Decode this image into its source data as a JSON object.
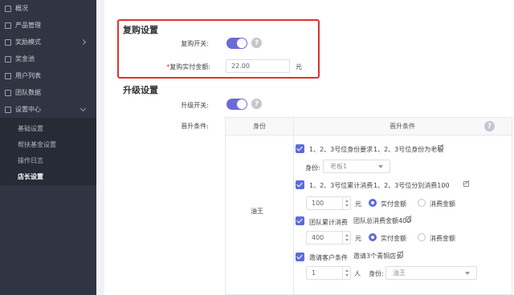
{
  "sidebar": {
    "items": [
      {
        "label": "概况"
      },
      {
        "label": "产品管理"
      },
      {
        "label": "奖励模式"
      },
      {
        "label": "奖金池"
      },
      {
        "label": "用户列表"
      },
      {
        "label": "团队数据"
      },
      {
        "label": "设置中心"
      }
    ],
    "sub_items": [
      {
        "label": "基础设置"
      },
      {
        "label": "帮扶基金设置"
      },
      {
        "label": "操作日志"
      },
      {
        "label": "店长设置"
      }
    ],
    "active_sub": "店长设置"
  },
  "repurchase": {
    "title": "复购设置",
    "switch_label": "复购开关:",
    "switch_on": true,
    "amount_label": "复购实付金额:",
    "amount_value": "22.00",
    "amount_unit": "元"
  },
  "upgrade": {
    "title": "升级设置",
    "switch_label": "升级开关:",
    "switch_on": true,
    "condition_label": "晋升条件:",
    "table": {
      "col_identity": "身份",
      "col_condition": "晋升条件",
      "row_identity": "油王",
      "conditions": {
        "c1_label": "1、2、3号位身份要求",
        "c1_desc": "1、2、3号位身份为老板",
        "identity_label": "身份:",
        "identity_value": "老板1",
        "c2_label": "1、2、3号位累计消费",
        "c2_desc": "1、2、3号位分别消费100",
        "c2_value": "100",
        "c2_unit": "元",
        "radio_paid": "实付金额",
        "radio_consume": "消费金额",
        "c3_label": "团队累计消费",
        "c3_desc": "团队总消费金额400",
        "c3_value": "400",
        "c3_unit": "元",
        "c4_label": "邀请客户条件",
        "c4_desc": "邀请3个青铜店长",
        "c4_value": "1",
        "c4_unit": "人",
        "c4_identity_label": "身份:",
        "c4_identity_value": "油王"
      }
    }
  },
  "icons": {
    "help": "question-circle-icon",
    "edit": "edit-icon",
    "checkbox": "checkbox-checked-icon"
  },
  "colors": {
    "accent": "#5c6bd9",
    "toggle": "#6c6bd6",
    "highlight": "#e0312b",
    "sidebar": "#2f3542"
  }
}
